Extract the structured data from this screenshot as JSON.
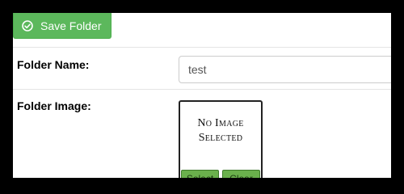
{
  "toolbar": {
    "save_label": "Save Folder",
    "save_icon": "check-circle-icon"
  },
  "form": {
    "folder_name_label": "Folder Name:",
    "folder_name_value": "test",
    "folder_image_label": "Folder Image:",
    "image_placeholder_line1": "No Image",
    "image_placeholder_line2": "Selected",
    "select_label": "Select",
    "clear_label": "Clear"
  },
  "colors": {
    "button_green": "#5cb85c",
    "image_button_green": "#6ab04c"
  }
}
